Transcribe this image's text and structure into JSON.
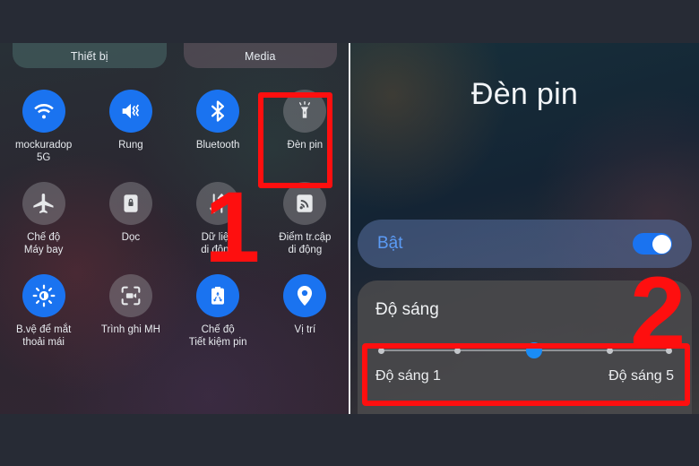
{
  "top_tabs": [
    {
      "label": "Thiết bị",
      "name": "tab-device"
    },
    {
      "label": "Media",
      "name": "tab-media"
    }
  ],
  "quick_settings": {
    "tiles": [
      {
        "label": "mockuradop\n5G",
        "icon": "wifi-icon",
        "state": "on"
      },
      {
        "label": "Rung",
        "icon": "vibrate-icon",
        "state": "on"
      },
      {
        "label": "Bluetooth",
        "icon": "bluetooth-icon",
        "state": "on"
      },
      {
        "label": "Đèn pin",
        "icon": "flashlight-icon",
        "state": "off"
      },
      {
        "label": "Chế độ\nMáy bay",
        "icon": "airplane-icon",
        "state": "off"
      },
      {
        "label": "Dọc",
        "icon": "rotation-lock-icon",
        "state": "off"
      },
      {
        "label": "Dữ liệu\ndi động",
        "icon": "mobile-data-icon",
        "state": "off"
      },
      {
        "label": "Điểm tr.cập\ndi động",
        "icon": "hotspot-icon",
        "state": "off"
      },
      {
        "label": "B.vệ để mắt\nthoải mái",
        "icon": "eye-comfort-icon",
        "state": "on"
      },
      {
        "label": "Trình ghi MH",
        "icon": "screen-record-icon",
        "state": "off"
      },
      {
        "label": "Chế độ\nTiết kiệm pin",
        "icon": "battery-saver-icon",
        "state": "on"
      },
      {
        "label": "Vị trí",
        "icon": "location-pin-icon",
        "state": "on"
      }
    ]
  },
  "flashlight_detail": {
    "title": "Đèn pin",
    "power": {
      "label": "Bật",
      "toggle_on": true
    },
    "brightness": {
      "title": "Độ sáng",
      "min_label": "Độ sáng 1",
      "max_label": "Độ sáng 5",
      "levels": 5,
      "value": 3
    }
  },
  "annotations": {
    "step_one": "1",
    "step_two": "2",
    "highlight_color": "#fe0f0f"
  }
}
